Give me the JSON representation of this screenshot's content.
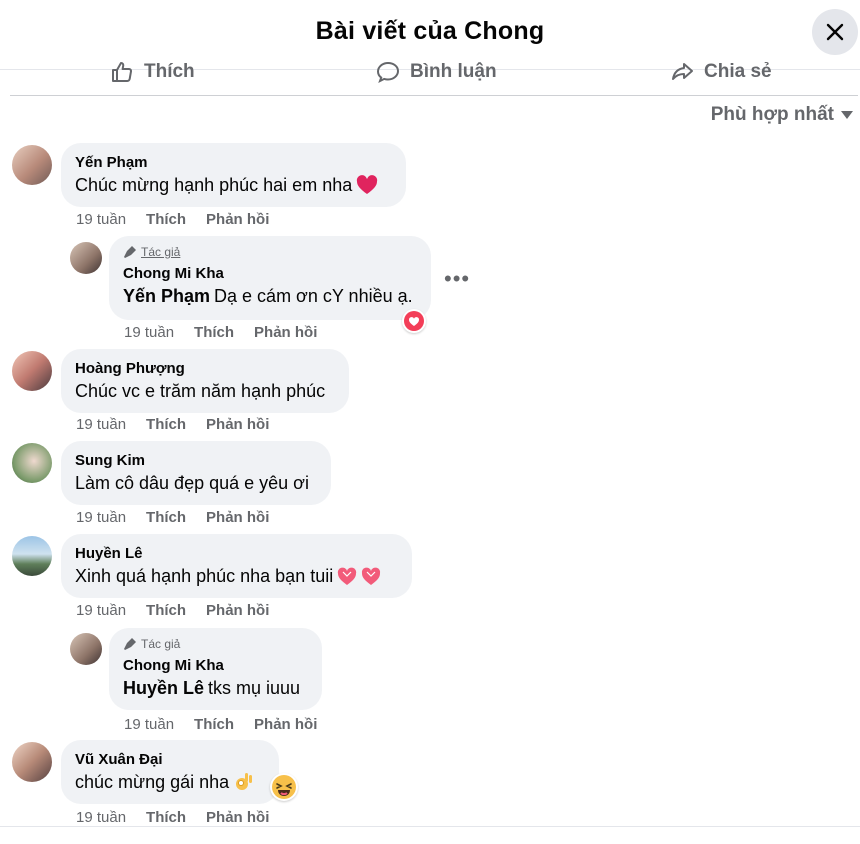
{
  "header": {
    "title": "Bài viết của Chong"
  },
  "actions": {
    "like": "Thích",
    "comment": "Bình luận",
    "share": "Chia sẻ"
  },
  "sort": {
    "label": "Phù hợp nhất"
  },
  "labels": {
    "author_badge": "Tác giả",
    "like": "Thích",
    "reply": "Phản hồi"
  },
  "comments": [
    {
      "author": "Yến Phạm",
      "text": "Chúc mừng hạnh phúc hai em nha",
      "emoji": "red-heart",
      "time": "19 tuần"
    },
    {
      "author": "Chong Mi Kha",
      "mention": "Yến Phạm",
      "text": "Dạ e cám ơn cY nhiều ạ.",
      "time": "19 tuần",
      "reaction": "love",
      "is_author": true
    },
    {
      "author": "Hoàng Phượng",
      "text": "Chúc vc e trăm năm hạnh phúc",
      "time": "19 tuần"
    },
    {
      "author": "Sung Kim",
      "text": "Làm cô dâu đẹp quá e yêu ơi",
      "time": "19 tuần"
    },
    {
      "author": "Huyền Lê",
      "text": "Xinh quá hạnh phúc nha bạn tuii",
      "emoji": "two-hearts",
      "time": "19 tuần"
    },
    {
      "author": "Chong Mi Kha",
      "mention": "Huyền Lê",
      "text": "tks mụ iuuu",
      "time": "19 tuần",
      "is_author": true
    },
    {
      "author": "Vũ Xuân Đại",
      "text": "chúc mừng gái nha",
      "emoji": "ok-hand laughing-face",
      "time": "19 tuần"
    }
  ],
  "colors": {
    "bubble": "#f0f2f5",
    "meta": "#65676b",
    "love": "#f33e58"
  }
}
